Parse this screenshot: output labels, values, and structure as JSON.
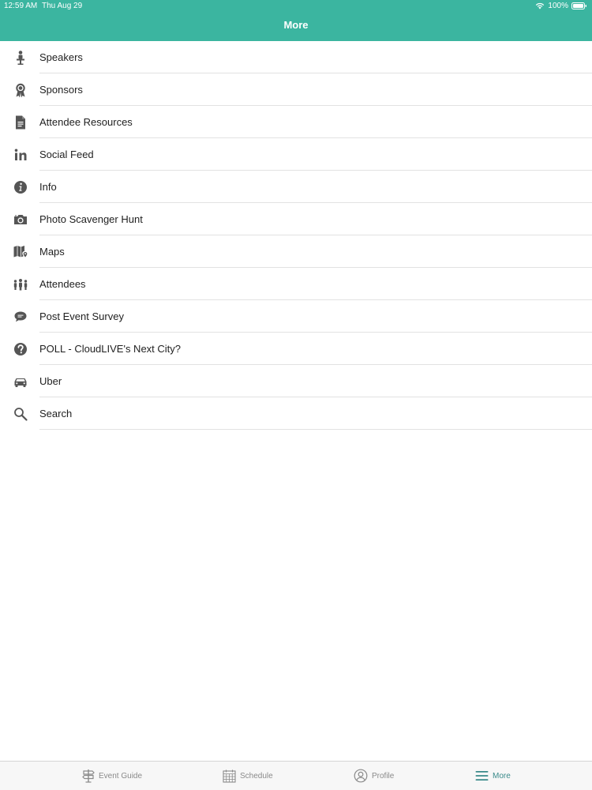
{
  "status_bar": {
    "time": "12:59 AM",
    "date": "Thu Aug 29",
    "battery": "100%"
  },
  "header": {
    "title": "More",
    "color": "#3bb5a0"
  },
  "menu": {
    "items": [
      {
        "label": "Speakers",
        "icon": "speaker-podium-icon"
      },
      {
        "label": "Sponsors",
        "icon": "ribbon-award-icon"
      },
      {
        "label": "Attendee Resources",
        "icon": "document-icon"
      },
      {
        "label": "Social Feed",
        "icon": "linkedin-icon"
      },
      {
        "label": "Info",
        "icon": "info-icon"
      },
      {
        "label": "Photo Scavenger Hunt",
        "icon": "camera-icon"
      },
      {
        "label": "Maps",
        "icon": "map-pin-icon"
      },
      {
        "label": "Attendees",
        "icon": "people-icon"
      },
      {
        "label": "Post Event Survey",
        "icon": "chat-bubble-icon"
      },
      {
        "label": "POLL - CloudLIVE's Next City?",
        "icon": "question-icon"
      },
      {
        "label": "Uber",
        "icon": "car-icon"
      },
      {
        "label": "Search",
        "icon": "search-icon"
      }
    ]
  },
  "tab_bar": {
    "tabs": [
      {
        "label": "Event Guide",
        "icon": "signpost-icon",
        "active": false
      },
      {
        "label": "Schedule",
        "icon": "calendar-icon",
        "active": false
      },
      {
        "label": "Profile",
        "icon": "profile-icon",
        "active": false
      },
      {
        "label": "More",
        "icon": "menu-icon",
        "active": true
      }
    ],
    "active_color": "#3a8a8a",
    "inactive_color": "#8a8a8a"
  }
}
